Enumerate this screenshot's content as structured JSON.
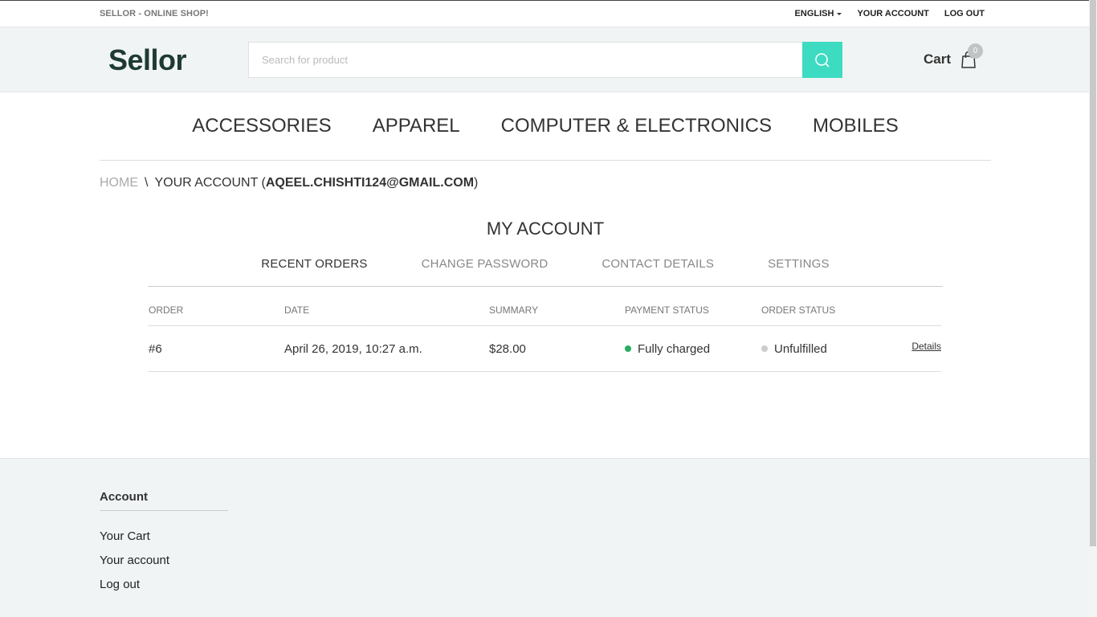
{
  "topbar": {
    "tagline": "SELLOR - ONLINE SHOP!",
    "language": "ENGLISH",
    "account": "YOUR ACCOUNT",
    "logout": "LOG OUT"
  },
  "header": {
    "logo": "Sellor",
    "search_placeholder": "Search for product",
    "cart_label": "Cart",
    "cart_count": "0"
  },
  "nav": [
    "ACCESSORIES",
    "APPAREL",
    "COMPUTER & ELECTRONICS",
    "MOBILES"
  ],
  "breadcrumb": {
    "home": "HOME",
    "sep": "\\",
    "prefix": "YOUR ACCOUNT (",
    "email": "AQEEL.CHISHTI124@GMAIL.COM",
    "suffix": ")"
  },
  "account": {
    "title": "MY ACCOUNT",
    "tabs": [
      "RECENT ORDERS",
      "CHANGE PASSWORD",
      "CONTACT DETAILS",
      "SETTINGS"
    ]
  },
  "orders": {
    "headers": [
      "ORDER",
      "DATE",
      "SUMMARY",
      "PAYMENT STATUS",
      "ORDER STATUS"
    ],
    "rows": [
      {
        "order": "#6",
        "date": "April 26, 2019, 10:27 a.m.",
        "summary": "$28.00",
        "payment_status": "Fully charged",
        "order_status": "Unfulfilled",
        "details": "Details"
      }
    ]
  },
  "status_colors": {
    "paid": "#27ae60",
    "unfulfilled": "#cccccc"
  },
  "footer": {
    "heading": "Account",
    "links": [
      "Your Cart",
      "Your account",
      "Log out"
    ]
  }
}
